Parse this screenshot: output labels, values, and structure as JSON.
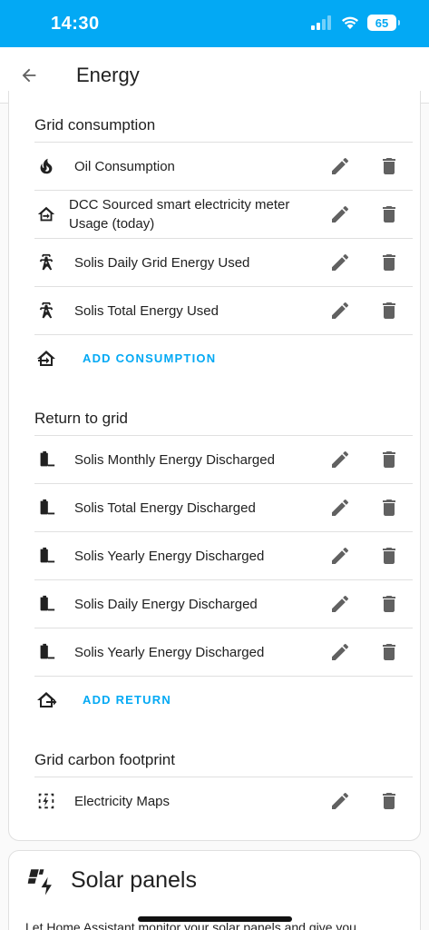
{
  "status_bar": {
    "time": "14:30",
    "battery": "65"
  },
  "app_bar": {
    "title": "Energy"
  },
  "grid_consumption": {
    "title": "Grid consumption",
    "items": [
      {
        "label": "Oil Consumption",
        "icon": "fire-icon"
      },
      {
        "label_line1": "DCC Sourced smart electricity meter",
        "label_line2": "Usage (today)",
        "icon": "home-import-icon"
      },
      {
        "label": "Solis Daily Grid Energy Used",
        "icon": "transmission-tower-icon"
      },
      {
        "label": "Solis Total Energy Used",
        "icon": "transmission-tower-icon"
      }
    ],
    "add_label": "ADD CONSUMPTION"
  },
  "return_to_grid": {
    "title": "Return to grid",
    "items": [
      {
        "label": "Solis Monthly Energy Discharged",
        "icon": "battery-minus-icon"
      },
      {
        "label": "Solis Total Energy Discharged",
        "icon": "battery-minus-icon"
      },
      {
        "label": "Solis Yearly Energy Discharged",
        "icon": "battery-minus-icon"
      },
      {
        "label": "Solis Daily Energy Discharged",
        "icon": "battery-minus-icon"
      },
      {
        "label": "Solis Yearly Energy Discharged",
        "icon": "battery-minus-icon"
      }
    ],
    "add_label": "ADD RETURN"
  },
  "grid_carbon": {
    "title": "Grid carbon footprint",
    "items": [
      {
        "label": "Electricity Maps",
        "icon": "lightning-dashed-icon"
      }
    ]
  },
  "solar": {
    "title": "Solar panels",
    "description": "Let Home Assistant monitor your solar panels and give you"
  },
  "colors": {
    "accent": "#03a9f4",
    "icon_gray": "#616161"
  }
}
